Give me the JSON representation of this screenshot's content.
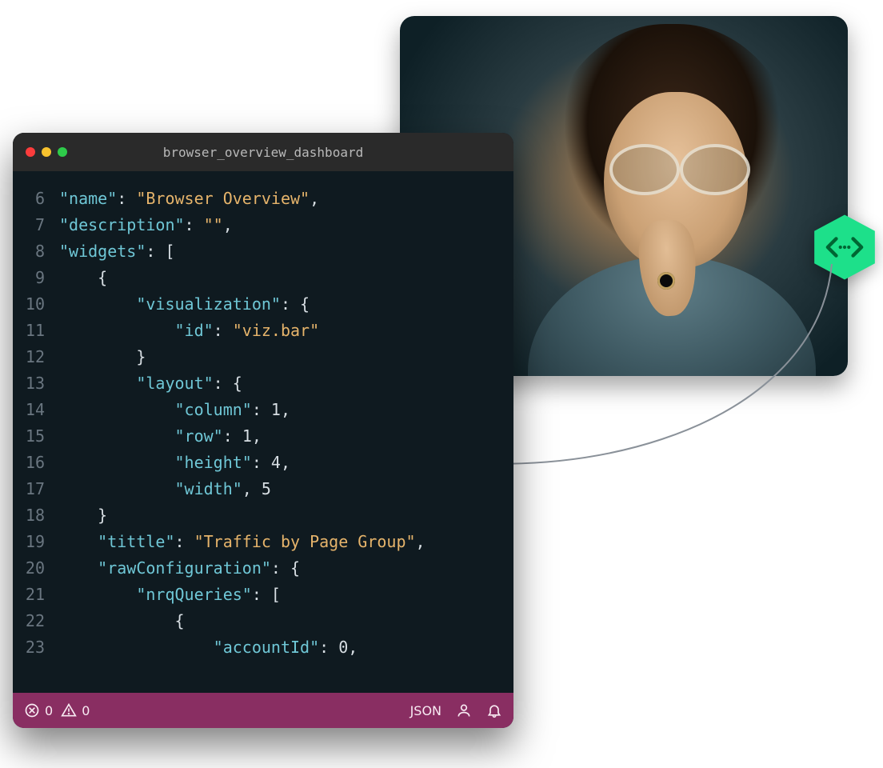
{
  "photo": {
    "alt": "Person with glasses looking at screen"
  },
  "badge": {
    "icon_name": "code-icon",
    "color": "#1de08a"
  },
  "editor": {
    "tab_title": "browser_overview_dashboard",
    "traffic": {
      "close": "close",
      "minimize": "minimize",
      "zoom": "zoom"
    },
    "gutter_start": 6,
    "lines": [
      {
        "n": "6",
        "indent": "",
        "segs": [
          {
            "t": "\"name\"",
            "c": "key"
          },
          {
            "t": ": ",
            "c": "punct"
          },
          {
            "t": "\"Browser Overview\"",
            "c": "str"
          },
          {
            "t": ",",
            "c": "punct"
          }
        ]
      },
      {
        "n": "7",
        "indent": "",
        "segs": [
          {
            "t": "\"description\"",
            "c": "key"
          },
          {
            "t": ": ",
            "c": "punct"
          },
          {
            "t": "\"\"",
            "c": "str"
          },
          {
            "t": ",",
            "c": "punct"
          }
        ]
      },
      {
        "n": "8",
        "indent": "",
        "segs": [
          {
            "t": "\"widgets\"",
            "c": "key"
          },
          {
            "t": ": [",
            "c": "punct"
          }
        ]
      },
      {
        "n": "9",
        "indent": "    ",
        "segs": [
          {
            "t": "{",
            "c": "punct"
          }
        ]
      },
      {
        "n": "10",
        "indent": "        ",
        "segs": [
          {
            "t": "\"visualization\"",
            "c": "key"
          },
          {
            "t": ": {",
            "c": "punct"
          }
        ]
      },
      {
        "n": "11",
        "indent": "            ",
        "segs": [
          {
            "t": "\"id\"",
            "c": "key"
          },
          {
            "t": ": ",
            "c": "punct"
          },
          {
            "t": "\"viz.bar\"",
            "c": "str"
          }
        ]
      },
      {
        "n": "12",
        "indent": "        ",
        "segs": [
          {
            "t": "}",
            "c": "punct"
          }
        ]
      },
      {
        "n": "13",
        "indent": "        ",
        "segs": [
          {
            "t": "\"layout\"",
            "c": "key"
          },
          {
            "t": ": {",
            "c": "punct"
          }
        ]
      },
      {
        "n": "14",
        "indent": "            ",
        "segs": [
          {
            "t": "\"column\"",
            "c": "key"
          },
          {
            "t": ": ",
            "c": "punct"
          },
          {
            "t": "1",
            "c": "num"
          },
          {
            "t": ",",
            "c": "punct"
          }
        ]
      },
      {
        "n": "15",
        "indent": "            ",
        "segs": [
          {
            "t": "\"row\"",
            "c": "key"
          },
          {
            "t": ": ",
            "c": "punct"
          },
          {
            "t": "1",
            "c": "num"
          },
          {
            "t": ",",
            "c": "punct"
          }
        ]
      },
      {
        "n": "16",
        "indent": "            ",
        "segs": [
          {
            "t": "\"height\"",
            "c": "key"
          },
          {
            "t": ": ",
            "c": "punct"
          },
          {
            "t": "4",
            "c": "num"
          },
          {
            "t": ",",
            "c": "punct"
          }
        ]
      },
      {
        "n": "17",
        "indent": "            ",
        "segs": [
          {
            "t": "\"width\"",
            "c": "key"
          },
          {
            "t": ", ",
            "c": "punct"
          },
          {
            "t": "5",
            "c": "num"
          }
        ]
      },
      {
        "n": "18",
        "indent": "    ",
        "segs": [
          {
            "t": "}",
            "c": "punct"
          }
        ]
      },
      {
        "n": "19",
        "indent": "    ",
        "segs": [
          {
            "t": "\"tittle\"",
            "c": "key"
          },
          {
            "t": ": ",
            "c": "punct"
          },
          {
            "t": "\"Traffic by Page Group\"",
            "c": "str"
          },
          {
            "t": ",",
            "c": "punct"
          }
        ]
      },
      {
        "n": "20",
        "indent": "    ",
        "segs": [
          {
            "t": "\"rawConfiguration\"",
            "c": "key"
          },
          {
            "t": ": {",
            "c": "punct"
          }
        ]
      },
      {
        "n": "21",
        "indent": "        ",
        "segs": [
          {
            "t": "\"nrqQueries\"",
            "c": "key"
          },
          {
            "t": ": [",
            "c": "punct"
          }
        ]
      },
      {
        "n": "22",
        "indent": "            ",
        "segs": [
          {
            "t": "{",
            "c": "punct"
          }
        ]
      },
      {
        "n": "23",
        "indent": "                ",
        "segs": [
          {
            "t": "\"accountId\"",
            "c": "key"
          },
          {
            "t": ": ",
            "c": "punct"
          },
          {
            "t": "0",
            "c": "num"
          },
          {
            "t": ",",
            "c": "punct"
          }
        ]
      }
    ]
  },
  "statusbar": {
    "errors": "0",
    "warnings": "0",
    "language": "JSON"
  }
}
